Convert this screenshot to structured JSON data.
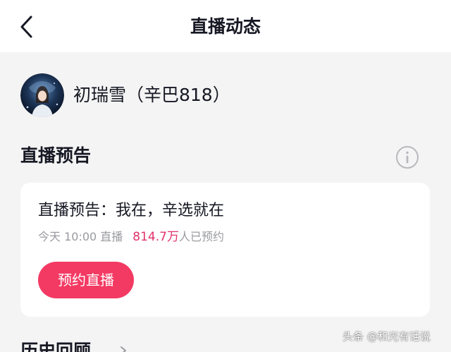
{
  "header": {
    "title": "直播动态",
    "back_icon": "chevron-left-icon"
  },
  "profile": {
    "name": "初瑞雪（辛巴818）",
    "avatar_icon": "avatar"
  },
  "preview_section": {
    "title": "直播预告",
    "info_icon": "info-icon",
    "card": {
      "title": "直播预告：我在，辛选就在",
      "time": "今天 10:00 直播",
      "reservation_count": "814.7万",
      "reservation_suffix": "人已预约",
      "reserve_button": "预约直播"
    }
  },
  "history_section": {
    "title": "历史回顾",
    "chevron_icon": "chevron-right-icon"
  },
  "watermark": "头条 @和光有话说",
  "colors": {
    "accent": "#f33a63",
    "count_text": "#e0326a",
    "muted_text": "#9a9ba0",
    "background": "#f4f4f4"
  }
}
